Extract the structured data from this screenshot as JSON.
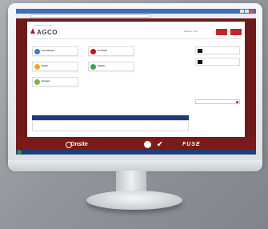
{
  "app": {
    "brand": "AGCO",
    "tagline": "Your Agriculture Company",
    "user_info": "Welcome, User",
    "header_buttons": [
      "",
      ""
    ],
    "left_section_label": "",
    "right_section_label": ""
  },
  "tiles": [
    {
      "title": "Consultant",
      "subtitle": "",
      "color": "#3a7fc4"
    },
    {
      "title": "Order",
      "subtitle": "",
      "color": "#f3a81c"
    },
    {
      "title": "Groups",
      "subtitle": "",
      "color": "#7cb441"
    },
    {
      "title": "To Read",
      "subtitle": "",
      "color": "#c8102e"
    },
    {
      "title": "Admin",
      "subtitle": "",
      "color": "#3aa655"
    }
  ],
  "videos": [
    {
      "title": "",
      "subtitle": ""
    },
    {
      "title": "",
      "subtitle": ""
    }
  ],
  "records": {
    "header": "",
    "body": ""
  },
  "footer": {
    "brand": "Onsite",
    "copyright": "",
    "partner": "FUSE"
  },
  "colors": {
    "brand_red": "#c0272d",
    "header_blue": "#1e3a7a",
    "footer_red": "#7a1a1a"
  }
}
